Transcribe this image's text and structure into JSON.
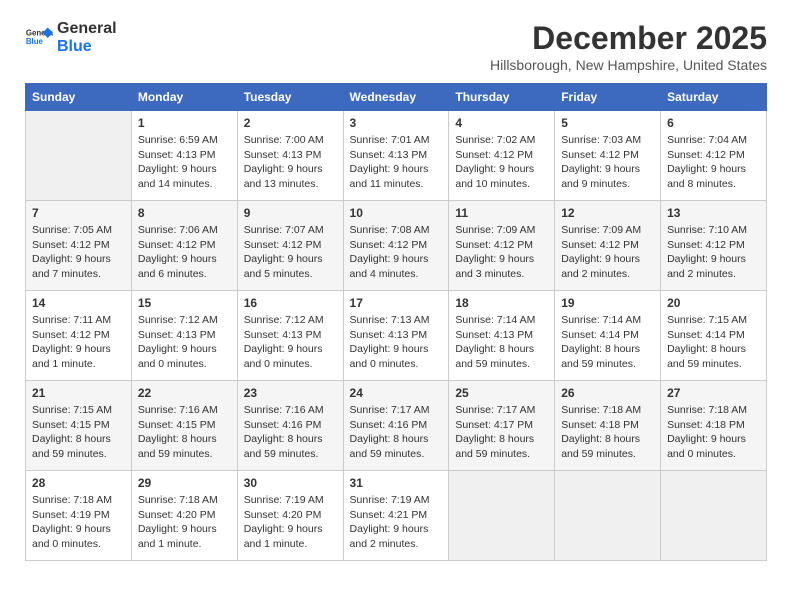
{
  "header": {
    "logo_line1": "General",
    "logo_line2": "Blue",
    "month": "December 2025",
    "location": "Hillsborough, New Hampshire, United States"
  },
  "weekdays": [
    "Sunday",
    "Monday",
    "Tuesday",
    "Wednesday",
    "Thursday",
    "Friday",
    "Saturday"
  ],
  "weeks": [
    [
      {
        "num": "",
        "info": ""
      },
      {
        "num": "1",
        "info": "Sunrise: 6:59 AM\nSunset: 4:13 PM\nDaylight: 9 hours\nand 14 minutes."
      },
      {
        "num": "2",
        "info": "Sunrise: 7:00 AM\nSunset: 4:13 PM\nDaylight: 9 hours\nand 13 minutes."
      },
      {
        "num": "3",
        "info": "Sunrise: 7:01 AM\nSunset: 4:13 PM\nDaylight: 9 hours\nand 11 minutes."
      },
      {
        "num": "4",
        "info": "Sunrise: 7:02 AM\nSunset: 4:12 PM\nDaylight: 9 hours\nand 10 minutes."
      },
      {
        "num": "5",
        "info": "Sunrise: 7:03 AM\nSunset: 4:12 PM\nDaylight: 9 hours\nand 9 minutes."
      },
      {
        "num": "6",
        "info": "Sunrise: 7:04 AM\nSunset: 4:12 PM\nDaylight: 9 hours\nand 8 minutes."
      }
    ],
    [
      {
        "num": "7",
        "info": "Sunrise: 7:05 AM\nSunset: 4:12 PM\nDaylight: 9 hours\nand 7 minutes."
      },
      {
        "num": "8",
        "info": "Sunrise: 7:06 AM\nSunset: 4:12 PM\nDaylight: 9 hours\nand 6 minutes."
      },
      {
        "num": "9",
        "info": "Sunrise: 7:07 AM\nSunset: 4:12 PM\nDaylight: 9 hours\nand 5 minutes."
      },
      {
        "num": "10",
        "info": "Sunrise: 7:08 AM\nSunset: 4:12 PM\nDaylight: 9 hours\nand 4 minutes."
      },
      {
        "num": "11",
        "info": "Sunrise: 7:09 AM\nSunset: 4:12 PM\nDaylight: 9 hours\nand 3 minutes."
      },
      {
        "num": "12",
        "info": "Sunrise: 7:09 AM\nSunset: 4:12 PM\nDaylight: 9 hours\nand 2 minutes."
      },
      {
        "num": "13",
        "info": "Sunrise: 7:10 AM\nSunset: 4:12 PM\nDaylight: 9 hours\nand 2 minutes."
      }
    ],
    [
      {
        "num": "14",
        "info": "Sunrise: 7:11 AM\nSunset: 4:12 PM\nDaylight: 9 hours\nand 1 minute."
      },
      {
        "num": "15",
        "info": "Sunrise: 7:12 AM\nSunset: 4:13 PM\nDaylight: 9 hours\nand 0 minutes."
      },
      {
        "num": "16",
        "info": "Sunrise: 7:12 AM\nSunset: 4:13 PM\nDaylight: 9 hours\nand 0 minutes."
      },
      {
        "num": "17",
        "info": "Sunrise: 7:13 AM\nSunset: 4:13 PM\nDaylight: 9 hours\nand 0 minutes."
      },
      {
        "num": "18",
        "info": "Sunrise: 7:14 AM\nSunset: 4:13 PM\nDaylight: 8 hours\nand 59 minutes."
      },
      {
        "num": "19",
        "info": "Sunrise: 7:14 AM\nSunset: 4:14 PM\nDaylight: 8 hours\nand 59 minutes."
      },
      {
        "num": "20",
        "info": "Sunrise: 7:15 AM\nSunset: 4:14 PM\nDaylight: 8 hours\nand 59 minutes."
      }
    ],
    [
      {
        "num": "21",
        "info": "Sunrise: 7:15 AM\nSunset: 4:15 PM\nDaylight: 8 hours\nand 59 minutes."
      },
      {
        "num": "22",
        "info": "Sunrise: 7:16 AM\nSunset: 4:15 PM\nDaylight: 8 hours\nand 59 minutes."
      },
      {
        "num": "23",
        "info": "Sunrise: 7:16 AM\nSunset: 4:16 PM\nDaylight: 8 hours\nand 59 minutes."
      },
      {
        "num": "24",
        "info": "Sunrise: 7:17 AM\nSunset: 4:16 PM\nDaylight: 8 hours\nand 59 minutes."
      },
      {
        "num": "25",
        "info": "Sunrise: 7:17 AM\nSunset: 4:17 PM\nDaylight: 8 hours\nand 59 minutes."
      },
      {
        "num": "26",
        "info": "Sunrise: 7:18 AM\nSunset: 4:18 PM\nDaylight: 8 hours\nand 59 minutes."
      },
      {
        "num": "27",
        "info": "Sunrise: 7:18 AM\nSunset: 4:18 PM\nDaylight: 9 hours\nand 0 minutes."
      }
    ],
    [
      {
        "num": "28",
        "info": "Sunrise: 7:18 AM\nSunset: 4:19 PM\nDaylight: 9 hours\nand 0 minutes."
      },
      {
        "num": "29",
        "info": "Sunrise: 7:18 AM\nSunset: 4:20 PM\nDaylight: 9 hours\nand 1 minute."
      },
      {
        "num": "30",
        "info": "Sunrise: 7:19 AM\nSunset: 4:20 PM\nDaylight: 9 hours\nand 1 minute."
      },
      {
        "num": "31",
        "info": "Sunrise: 7:19 AM\nSunset: 4:21 PM\nDaylight: 9 hours\nand 2 minutes."
      },
      {
        "num": "",
        "info": ""
      },
      {
        "num": "",
        "info": ""
      },
      {
        "num": "",
        "info": ""
      }
    ]
  ]
}
